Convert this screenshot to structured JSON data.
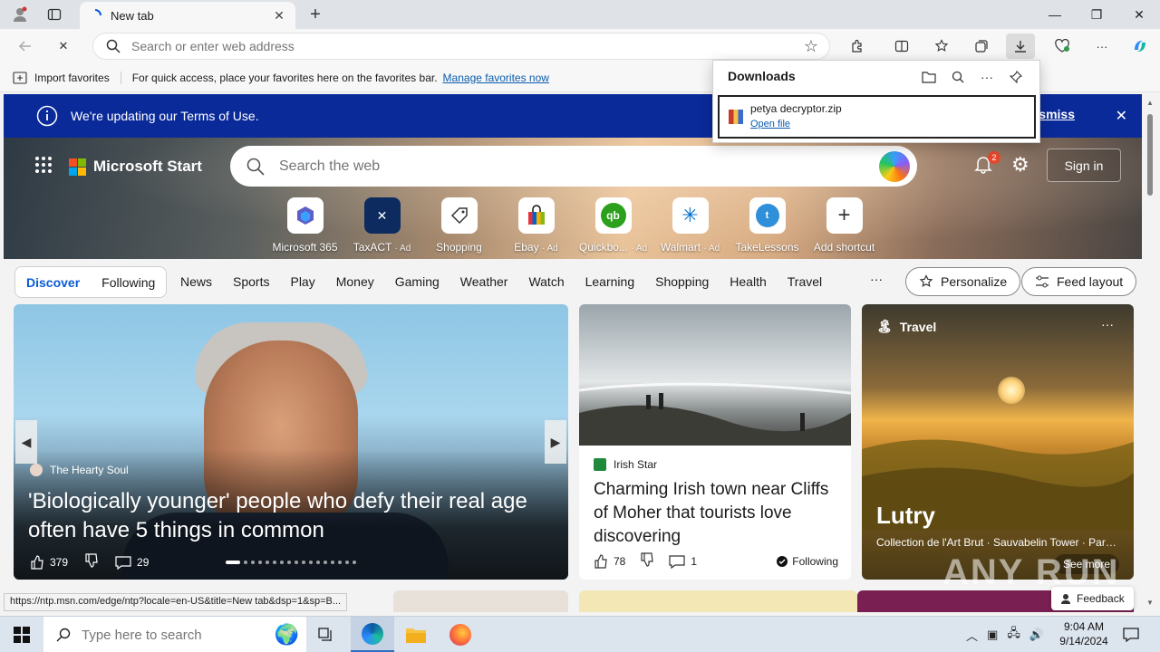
{
  "browser": {
    "tab_title": "New tab",
    "address_placeholder": "Search or enter web address"
  },
  "favorites_bar": {
    "import_label": "Import favorites",
    "hint": "For quick access, place your favorites here on the favorites bar.",
    "manage_link": "Manage favorites now"
  },
  "downloads": {
    "title": "Downloads",
    "file_name": "petya decryptor.zip",
    "open_file": "Open file"
  },
  "notice": {
    "text": "We're updating our Terms of Use.",
    "dismiss": "Dismiss"
  },
  "header": {
    "brand": "Microsoft Start",
    "search_placeholder": "Search the web",
    "notification_count": "2",
    "sign_in": "Sign in"
  },
  "shortcuts": [
    {
      "label": "Microsoft 365",
      "ad": "",
      "icon": "m365-icon"
    },
    {
      "label": "TaxACT",
      "ad": "· Ad",
      "icon": "taxact-icon"
    },
    {
      "label": "Shopping",
      "ad": "",
      "icon": "shopping-tag-icon"
    },
    {
      "label": "Ebay",
      "ad": "· Ad",
      "icon": "ebay-bag-icon"
    },
    {
      "label": "Quickbo...",
      "ad": "· Ad",
      "icon": "quickbooks-icon"
    },
    {
      "label": "Walmart",
      "ad": "· Ad",
      "icon": "walmart-icon"
    },
    {
      "label": "TakeLessons",
      "ad": "",
      "icon": "takelessons-icon"
    },
    {
      "label": "Add shortcut",
      "ad": "",
      "icon": "plus-icon"
    }
  ],
  "feed_nav": {
    "discover": "Discover",
    "following": "Following",
    "links": [
      "News",
      "Sports",
      "Play",
      "Money",
      "Gaming",
      "Weather",
      "Watch",
      "Learning",
      "Shopping",
      "Health",
      "Travel"
    ],
    "more": "···",
    "personalize": "Personalize",
    "feed_layout": "Feed layout"
  },
  "cards": {
    "main": {
      "source": "The Hearty Soul",
      "headline": "'Biologically younger' people who defy their real age often have 5 things in common",
      "likes": "379",
      "comments": "29"
    },
    "irish": {
      "source": "Irish Star",
      "headline": "Charming Irish town near Cliffs of Moher that tourists love discovering",
      "likes": "78",
      "comments": "1",
      "following": "Following"
    },
    "travel": {
      "label": "Travel",
      "title": "Lutry",
      "subtitle": "Collection de l'Art Brut · Sauvabelin Tower · Parc...",
      "see_more": "See more"
    }
  },
  "feedback": "Feedback",
  "status_url": "https://ntp.msn.com/edge/ntp?locale=en-US&title=New tab&dsp=1&sp=B...",
  "watermark": "ANY RUN",
  "taskbar": {
    "search_placeholder": "Type here to search",
    "time": "9:04 AM",
    "date": "9/14/2024"
  },
  "colors": {
    "notice_bg": "#0a2a9a",
    "accent": "#0a5bd6",
    "badge": "#e5482f"
  }
}
